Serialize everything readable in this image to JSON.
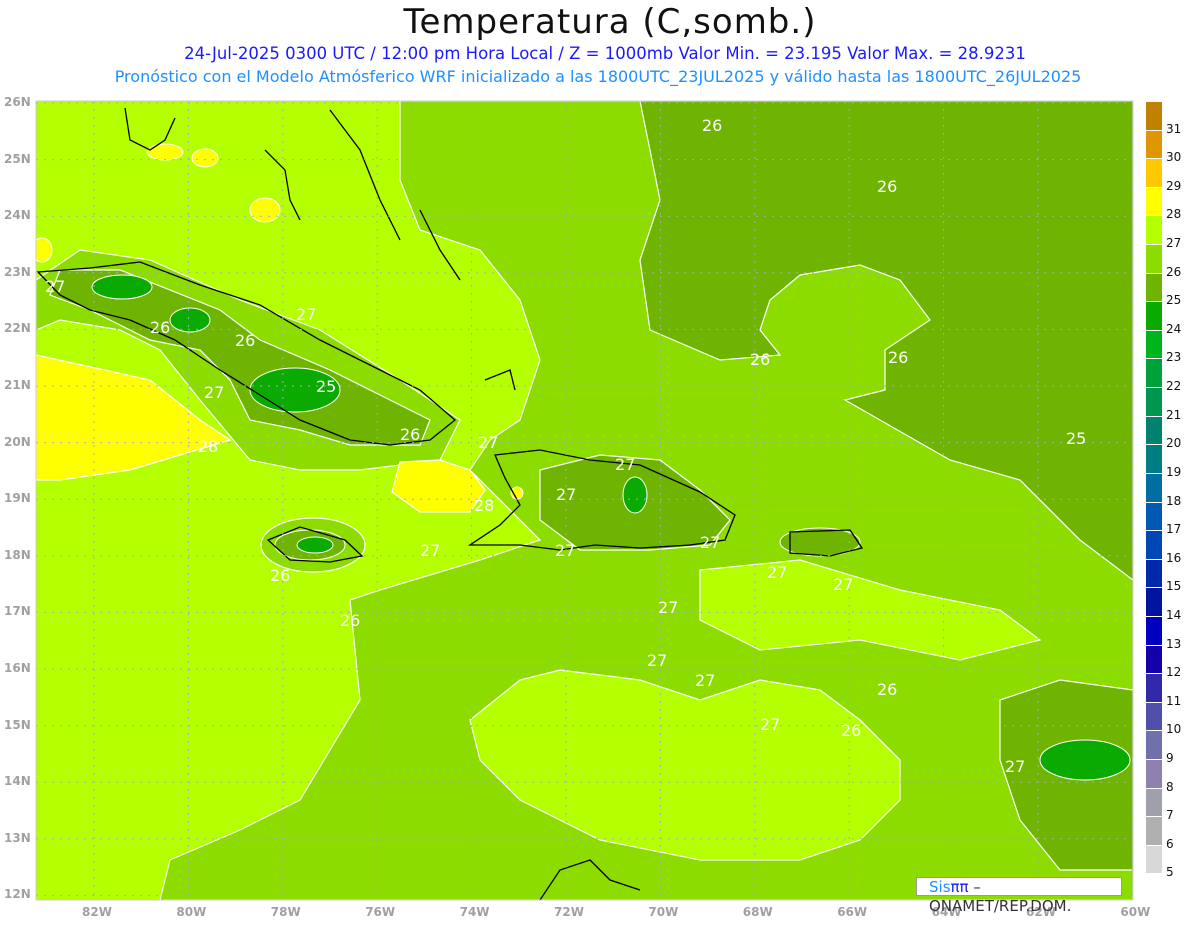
{
  "header": {
    "title": "Temperatura (C,somb.)",
    "subtitle": "24-Jul-2025  0300 UTC / 12:00 pm Hora Local / Z = 1000mb    Valor Min. = 23.195  Valor Max. = 28.9231",
    "forecast_note": "Pronóstico con el Modelo Atmósferico WRF inicializado a las 1800UTC_23JUL2025 y válido hasta las  1800UTC_26JUL2025"
  },
  "watermark": {
    "sis": "Sis",
    "pi": "ππ",
    "rest": " – ONAMET/REP.DOM."
  },
  "chart_data": {
    "type": "heatmap",
    "variable": "Temperature 1000mb (C)",
    "value_min": 23.195,
    "value_max": 28.9231,
    "lon_range": [
      -83.2,
      -60
    ],
    "lat_range": [
      12,
      26
    ],
    "x_ticks": [
      "82W",
      "80W",
      "78W",
      "76W",
      "74W",
      "72W",
      "70W",
      "68W",
      "66W",
      "64W",
      "62W",
      "60W"
    ],
    "x_tick_values": [
      -82,
      -80,
      -78,
      -76,
      -74,
      -72,
      -70,
      -68,
      -66,
      -64,
      -62,
      -60
    ],
    "y_ticks": [
      "26N",
      "25N",
      "24N",
      "23N",
      "22N",
      "21N",
      "20N",
      "19N",
      "18N",
      "17N",
      "16N",
      "15N",
      "14N",
      "13N",
      "12N"
    ],
    "y_tick_values": [
      26,
      25,
      24,
      23,
      22,
      21,
      20,
      19,
      18,
      17,
      16,
      15,
      14,
      13,
      12
    ],
    "grid": true,
    "colorbar": {
      "labels": [
        "31",
        "30",
        "29",
        "28",
        "27",
        "26",
        "25",
        "24",
        "23",
        "22",
        "21",
        "20",
        "19",
        "18",
        "17",
        "16",
        "15",
        "14",
        "13",
        "12",
        "11",
        "10",
        "9",
        "8",
        "7",
        "6",
        "5"
      ],
      "colors": [
        "#c08000",
        "#e09600",
        "#ffc800",
        "#ffff00",
        "#b4ff00",
        "#8cdc00",
        "#6eb400",
        "#0aaa00",
        "#00b41e",
        "#00a03c",
        "#009650",
        "#00826e",
        "#007d82",
        "#006ea0",
        "#005ab4",
        "#0046b4",
        "#0028aa",
        "#0014a0",
        "#0000be",
        "#1400aa",
        "#3228aa",
        "#5050aa",
        "#7070aa",
        "#9080b0",
        "#a0a0aa",
        "#b0b0b0",
        "#d8d8d8",
        "#ffffff"
      ]
    },
    "contour_labels": [
      "27",
      "26",
      "26",
      "27",
      "25",
      "26",
      "27",
      "28",
      "28",
      "27",
      "27",
      "26",
      "26",
      "27",
      "27",
      "27",
      "27",
      "27",
      "27",
      "27",
      "27",
      "26",
      "26",
      "26",
      "26",
      "26",
      "26",
      "25",
      "27",
      "27",
      "27"
    ]
  }
}
